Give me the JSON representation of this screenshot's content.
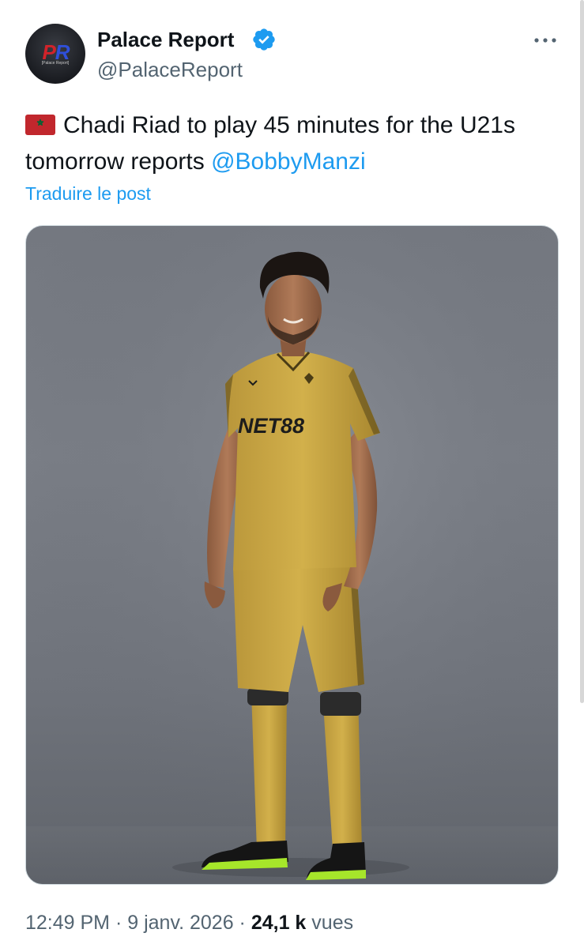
{
  "author": {
    "display_name": "Palace Report",
    "handle": "@PalaceReport",
    "avatar_logo_left": "P",
    "avatar_logo_right": "R",
    "avatar_subtitle": "[Palace Report]",
    "verified_icon": "verified-badge-icon"
  },
  "post": {
    "flag_icon": "morocco-flag-icon",
    "text_main": "Chadi Riad to play 45 minutes for the U21s tomorrow reports ",
    "mention": "@BobbyManzi",
    "translate_label": "Traduire le post"
  },
  "media": {
    "shirt_sponsor": "NET88"
  },
  "meta": {
    "time": "12:49 PM",
    "separator1": " · ",
    "date": "9 janv. 2026",
    "separator2": " · ",
    "views_count": "24,1 k",
    "views_label": " vues"
  },
  "colors": {
    "link": "#1d9bf0",
    "secondary_text": "#536471",
    "primary_text": "#0f1419",
    "kit_gold": "#c9a83f"
  }
}
